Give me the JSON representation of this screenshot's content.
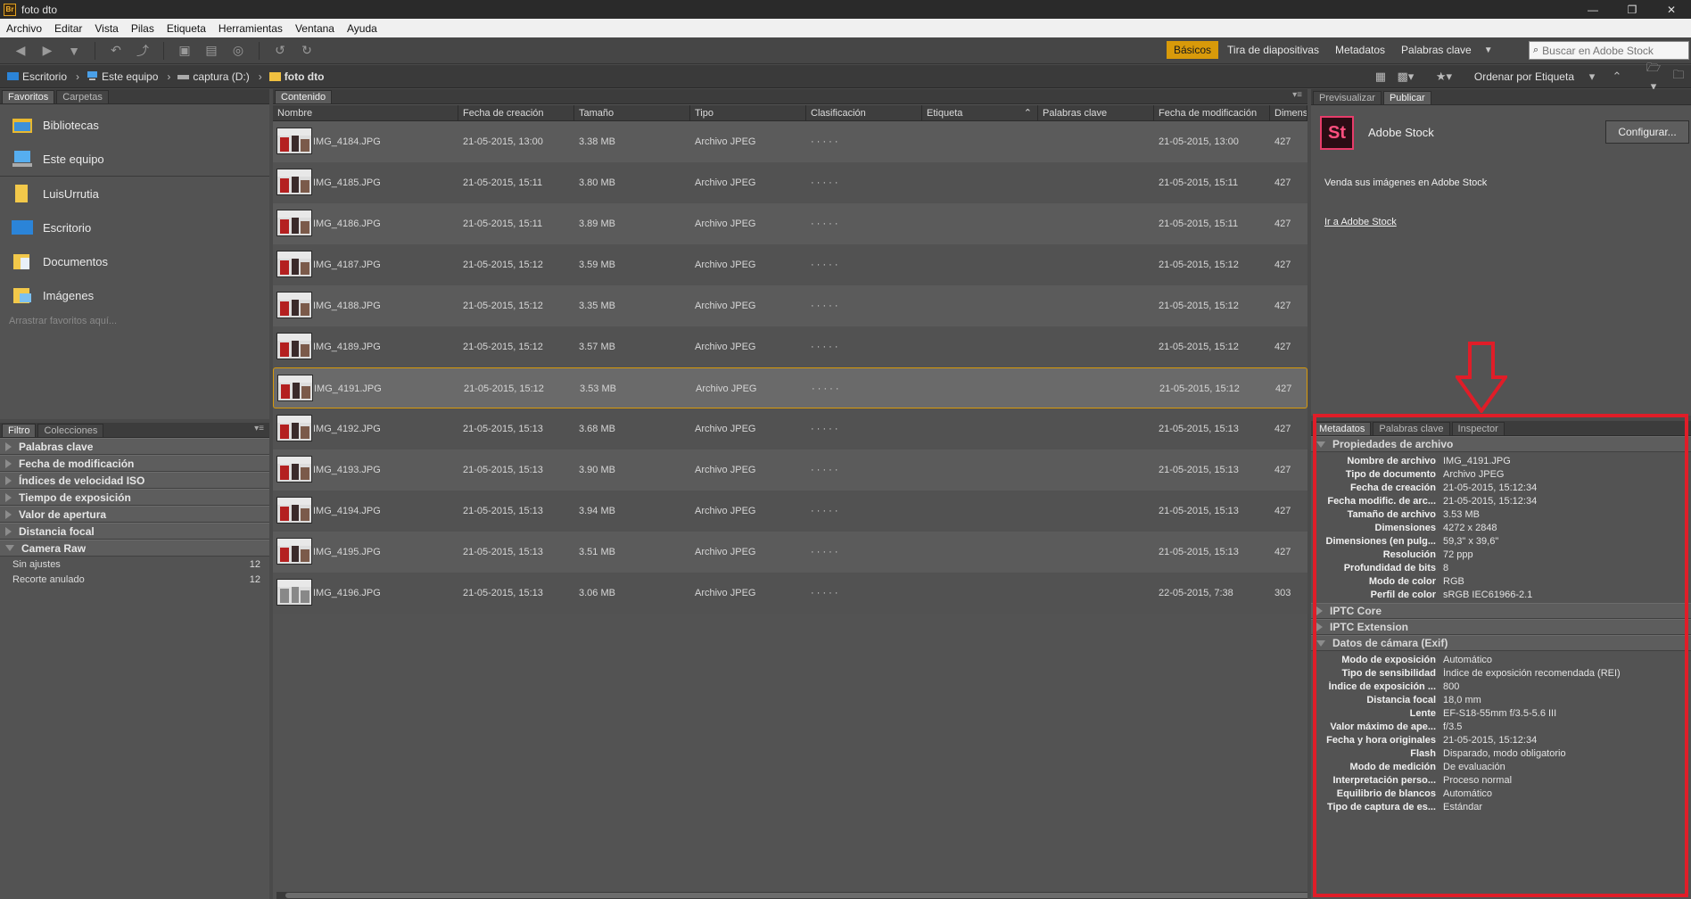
{
  "window": {
    "title": "foto dto",
    "app_icon": "Br"
  },
  "menu": [
    "Archivo",
    "Editar",
    "Vista",
    "Pilas",
    "Etiqueta",
    "Herramientas",
    "Ventana",
    "Ayuda"
  ],
  "workspaces": {
    "items": [
      "Básicos",
      "Tira de diapositivas",
      "Metadatos",
      "Palabras clave"
    ],
    "active_index": 0
  },
  "search": {
    "placeholder": "Buscar en Adobe Stock"
  },
  "path": [
    "Escritorio",
    "Este equipo",
    "captura (D:)",
    "foto dto"
  ],
  "sort_label": "Ordenar por Etiqueta",
  "left_tabs": [
    "Favoritos",
    "Carpetas"
  ],
  "favorites": {
    "items": [
      "Bibliotecas",
      "Este equipo",
      "LuisUrrutia",
      "Escritorio",
      "Documentos",
      "Imágenes"
    ],
    "hint": "Arrastrar favoritos aquí..."
  },
  "filter_tabs": [
    "Filtro",
    "Colecciones"
  ],
  "filters": {
    "collapsed": [
      "Palabras clave",
      "Fecha de modificación",
      "Índices de velocidad ISO",
      "Tiempo de exposición",
      "Valor de apertura",
      "Distancia focal"
    ],
    "expanded": "Camera Raw",
    "sub": [
      {
        "label": "Sin ajustes",
        "count": "12"
      },
      {
        "label": "Recorte anulado",
        "count": "12"
      }
    ]
  },
  "content": {
    "tab": "Contenido",
    "columns": [
      "Nombre",
      "Fecha de creación",
      "Tamaño",
      "Tipo",
      "Clasificación",
      "Etiqueta",
      "Palabras clave",
      "Fecha de modificación",
      "Dimens"
    ],
    "rows": [
      {
        "name": "IMG_4184.JPG",
        "created": "21-05-2015, 13:00",
        "size": "3.38 MB",
        "type": "Archivo JPEG",
        "rating": "· · · · ·",
        "modified": "21-05-2015, 13:00",
        "dim": "427"
      },
      {
        "name": "IMG_4185.JPG",
        "created": "21-05-2015, 15:11",
        "size": "3.80 MB",
        "type": "Archivo JPEG",
        "rating": "· · · · ·",
        "modified": "21-05-2015, 15:11",
        "dim": "427"
      },
      {
        "name": "IMG_4186.JPG",
        "created": "21-05-2015, 15:11",
        "size": "3.89 MB",
        "type": "Archivo JPEG",
        "rating": "· · · · ·",
        "modified": "21-05-2015, 15:11",
        "dim": "427"
      },
      {
        "name": "IMG_4187.JPG",
        "created": "21-05-2015, 15:12",
        "size": "3.59 MB",
        "type": "Archivo JPEG",
        "rating": "· · · · ·",
        "modified": "21-05-2015, 15:12",
        "dim": "427"
      },
      {
        "name": "IMG_4188.JPG",
        "created": "21-05-2015, 15:12",
        "size": "3.35 MB",
        "type": "Archivo JPEG",
        "rating": "· · · · ·",
        "modified": "21-05-2015, 15:12",
        "dim": "427"
      },
      {
        "name": "IMG_4189.JPG",
        "created": "21-05-2015, 15:12",
        "size": "3.57 MB",
        "type": "Archivo JPEG",
        "rating": "· · · · ·",
        "modified": "21-05-2015, 15:12",
        "dim": "427"
      },
      {
        "name": "IMG_4191.JPG",
        "created": "21-05-2015, 15:12",
        "size": "3.53 MB",
        "type": "Archivo JPEG",
        "rating": "· · · · ·",
        "modified": "21-05-2015, 15:12",
        "dim": "427"
      },
      {
        "name": "IMG_4192.JPG",
        "created": "21-05-2015, 15:13",
        "size": "3.68 MB",
        "type": "Archivo JPEG",
        "rating": "· · · · ·",
        "modified": "21-05-2015, 15:13",
        "dim": "427"
      },
      {
        "name": "IMG_4193.JPG",
        "created": "21-05-2015, 15:13",
        "size": "3.90 MB",
        "type": "Archivo JPEG",
        "rating": "· · · · ·",
        "modified": "21-05-2015, 15:13",
        "dim": "427"
      },
      {
        "name": "IMG_4194.JPG",
        "created": "21-05-2015, 15:13",
        "size": "3.94 MB",
        "type": "Archivo JPEG",
        "rating": "· · · · ·",
        "modified": "21-05-2015, 15:13",
        "dim": "427"
      },
      {
        "name": "IMG_4195.JPG",
        "created": "21-05-2015, 15:13",
        "size": "3.51 MB",
        "type": "Archivo JPEG",
        "rating": "· · · · ·",
        "modified": "21-05-2015, 15:13",
        "dim": "427"
      },
      {
        "name": "IMG_4196.JPG",
        "created": "21-05-2015, 15:13",
        "size": "3.06 MB",
        "type": "Archivo JPEG",
        "rating": "· · · · ·",
        "modified": "22-05-2015, 7:38",
        "dim": "303"
      }
    ],
    "selected_index": 6
  },
  "right_top_tabs": [
    "Previsualizar",
    "Publicar"
  ],
  "stock": {
    "logo": "St",
    "name": "Adobe Stock",
    "configure": "Configurar...",
    "sell": "Venda sus imágenes en Adobe Stock",
    "link": "Ir a Adobe Stock"
  },
  "meta_tabs": [
    "Metadatos",
    "Palabras clave",
    "Inspector"
  ],
  "metadata": {
    "file_props_title": "Propiedades de archivo",
    "file_props": [
      [
        "Nombre de archivo",
        "IMG_4191.JPG"
      ],
      [
        "Tipo de documento",
        "Archivo JPEG"
      ],
      [
        "Fecha de creación",
        "21-05-2015, 15:12:34"
      ],
      [
        "Fecha modific. de arc...",
        "21-05-2015, 15:12:34"
      ],
      [
        "Tamaño de archivo",
        "3.53 MB"
      ],
      [
        "Dimensiones",
        "4272 x 2848"
      ],
      [
        "Dimensiones (en pulg...",
        "59,3\" x 39,6\""
      ],
      [
        "Resolución",
        "72 ppp"
      ],
      [
        "Profundidad de bits",
        "8"
      ],
      [
        "Modo de color",
        "RGB"
      ],
      [
        "Perfil de color",
        "sRGB IEC61966-2.1"
      ]
    ],
    "iptc_core": "IPTC Core",
    "iptc_ext": "IPTC Extension",
    "exif_title": "Datos de cámara (Exif)",
    "exif": [
      [
        "Modo de exposición",
        "Automático"
      ],
      [
        "Tipo de sensibilidad",
        "Índice de exposición recomendada (REI)"
      ],
      [
        "Índice de exposición ...",
        "800"
      ],
      [
        "Distancia focal",
        "18,0 mm"
      ],
      [
        "Lente",
        "EF-S18-55mm f/3.5-5.6 III"
      ],
      [
        "Valor máximo de ape...",
        "f/3.5"
      ],
      [
        "Fecha y hora originales",
        "21-05-2015, 15:12:34"
      ],
      [
        "Flash",
        "Disparado, modo obligatorio"
      ],
      [
        "Modo de medición",
        "De evaluación"
      ],
      [
        "Interpretación perso...",
        "Proceso normal"
      ],
      [
        "Equilibrio de blancos",
        "Automático"
      ],
      [
        "Tipo de captura de es...",
        "Estándar"
      ]
    ]
  },
  "colors": {
    "accent": "#d89a0a",
    "annotation": "#e01d28",
    "stock": "#e83c6a"
  }
}
